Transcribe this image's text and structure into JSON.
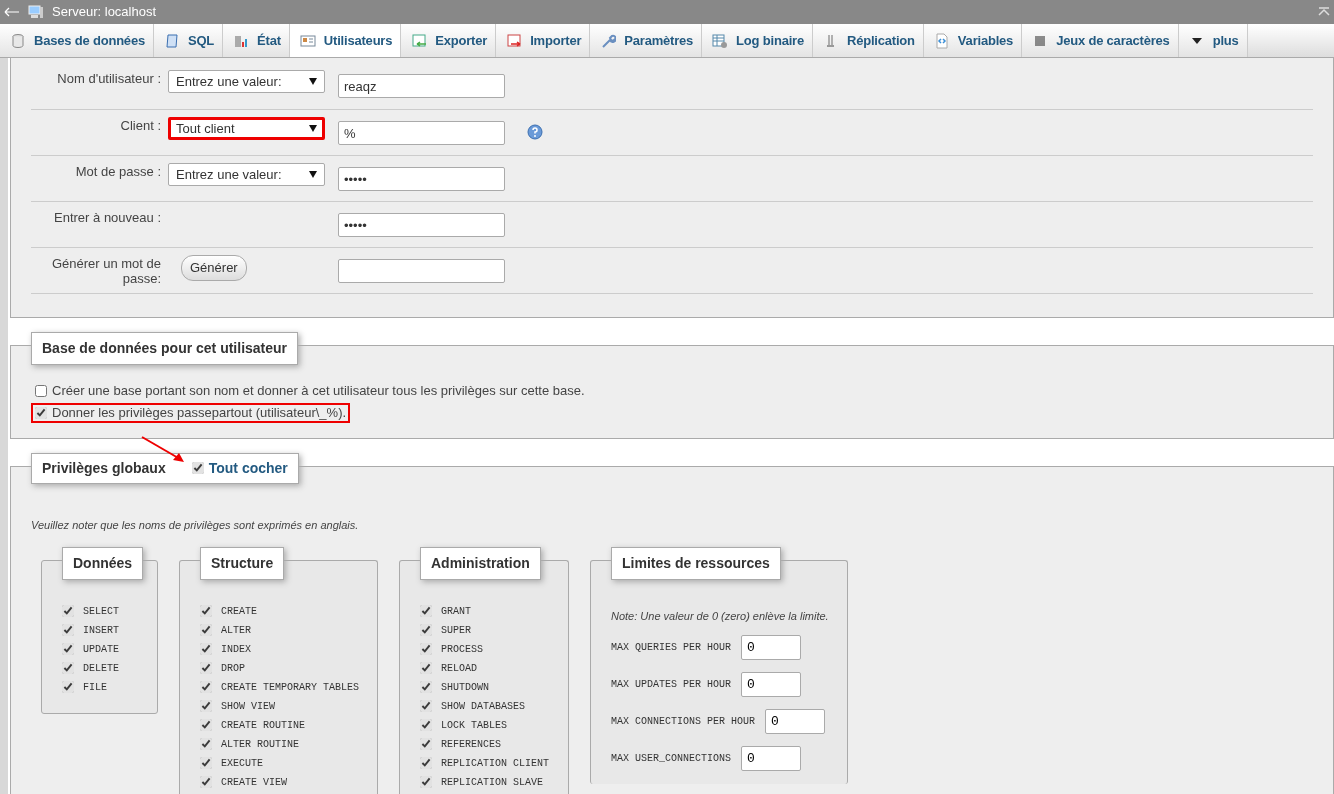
{
  "window": {
    "title": "Serveur: localhost"
  },
  "tabs": [
    {
      "label": "Bases de données",
      "kind": "database",
      "selected": false
    },
    {
      "label": "SQL",
      "kind": "sql",
      "selected": false
    },
    {
      "label": "État",
      "kind": "status",
      "selected": false
    },
    {
      "label": "Utilisateurs",
      "kind": "users",
      "selected": true
    },
    {
      "label": "Exporter",
      "kind": "export",
      "selected": false
    },
    {
      "label": "Importer",
      "kind": "import",
      "selected": false
    },
    {
      "label": "Paramètres",
      "kind": "settings",
      "selected": false
    },
    {
      "label": "Log binaire",
      "kind": "binlog",
      "selected": false
    },
    {
      "label": "Réplication",
      "kind": "replication",
      "selected": false
    },
    {
      "label": "Variables",
      "kind": "variables",
      "selected": false
    },
    {
      "label": "Jeux de caractères",
      "kind": "charset",
      "selected": false
    },
    {
      "label": "plus",
      "kind": "more",
      "selected": false
    }
  ],
  "login_form": {
    "rows": [
      {
        "label": "Nom d'utilisateur :",
        "select": "Entrez une valeur:",
        "value": "reaqz",
        "highlighted": false
      },
      {
        "label": "Client :",
        "select": "Tout client",
        "value": "%",
        "help": true,
        "highlighted": true
      },
      {
        "label": "Mot de passe :",
        "select": "Entrez une valeur:",
        "value": "•••••",
        "highlighted": false
      },
      {
        "label": "Entrer à nouveau :",
        "value": "•••••"
      },
      {
        "label": "Générer un mot de passe:",
        "button": "Générer"
      }
    ]
  },
  "database_section": {
    "title": "Base de données pour cet utilisateur",
    "options": [
      {
        "label": "Créer une base portant son nom et donner à cet utilisateur tous les privilèges sur cette base.",
        "checked": false,
        "highlighted": false
      },
      {
        "label": "Donner les privilèges passepartout (utilisateur\\_%).",
        "checked": true,
        "highlighted": true
      }
    ]
  },
  "global_privileges": {
    "title": "Privilèges globaux",
    "check_all": {
      "label": "Tout cocher",
      "checked": true
    },
    "note": "Veuillez noter que les noms de privilèges sont exprimés en anglais.",
    "groups": [
      {
        "title": "Données",
        "items": [
          {
            "label": "SELECT",
            "checked": true
          },
          {
            "label": "INSERT",
            "checked": true
          },
          {
            "label": "UPDATE",
            "checked": true
          },
          {
            "label": "DELETE",
            "checked": true
          },
          {
            "label": "FILE",
            "checked": true
          }
        ]
      },
      {
        "title": "Structure",
        "items": [
          {
            "label": "CREATE",
            "checked": true
          },
          {
            "label": "ALTER",
            "checked": true
          },
          {
            "label": "INDEX",
            "checked": true
          },
          {
            "label": "DROP",
            "checked": true
          },
          {
            "label": "CREATE TEMPORARY TABLES",
            "checked": true
          },
          {
            "label": "SHOW VIEW",
            "checked": true
          },
          {
            "label": "CREATE ROUTINE",
            "checked": true
          },
          {
            "label": "ALTER ROUTINE",
            "checked": true
          },
          {
            "label": "EXECUTE",
            "checked": true
          },
          {
            "label": "CREATE VIEW",
            "checked": true
          }
        ]
      },
      {
        "title": "Administration",
        "items": [
          {
            "label": "GRANT",
            "checked": true
          },
          {
            "label": "SUPER",
            "checked": true
          },
          {
            "label": "PROCESS",
            "checked": true
          },
          {
            "label": "RELOAD",
            "checked": true
          },
          {
            "label": "SHUTDOWN",
            "checked": true
          },
          {
            "label": "SHOW DATABASES",
            "checked": true
          },
          {
            "label": "LOCK TABLES",
            "checked": true
          },
          {
            "label": "REFERENCES",
            "checked": true
          },
          {
            "label": "REPLICATION CLIENT",
            "checked": true
          },
          {
            "label": "REPLICATION SLAVE",
            "checked": true
          }
        ]
      }
    ],
    "resource_limits": {
      "title": "Limites de ressources",
      "note": "Note: Une valeur de 0 (zero) enlève la limite.",
      "fields": [
        {
          "label": "MAX QUERIES PER HOUR",
          "value": "0"
        },
        {
          "label": "MAX UPDATES PER HOUR",
          "value": "0"
        },
        {
          "label": "MAX CONNECTIONS PER HOUR",
          "value": "0"
        },
        {
          "label": "MAX USER_CONNECTIONS",
          "value": "0"
        }
      ]
    }
  }
}
